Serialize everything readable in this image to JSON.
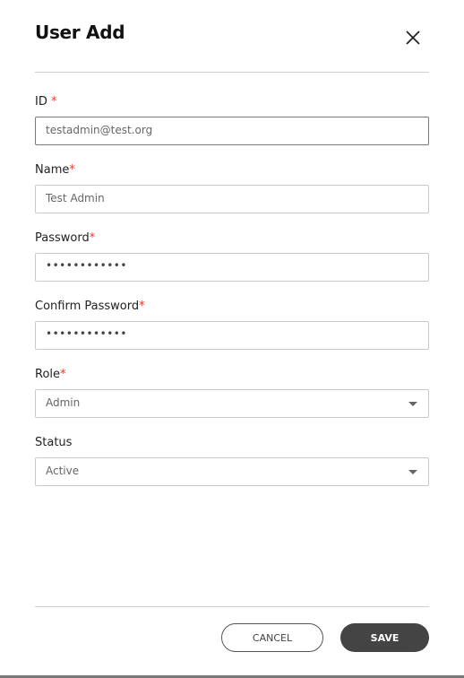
{
  "dialog": {
    "title": "User Add",
    "close_icon": "close-icon"
  },
  "fields": {
    "id": {
      "label": "ID",
      "required": "*",
      "value": "testadmin@test.org"
    },
    "name": {
      "label": "Name",
      "required": "*",
      "value": "Test Admin"
    },
    "password": {
      "label": "Password",
      "required": "*",
      "value": "••••••••••••"
    },
    "confirm_password": {
      "label": "Confirm Password",
      "required": "*",
      "value": "••••••••••••"
    },
    "role": {
      "label": "Role",
      "required": "*",
      "value": "Admin"
    },
    "status": {
      "label": "Status",
      "value": "Active"
    }
  },
  "footer": {
    "cancel_label": "CANCEL",
    "save_label": "SAVE"
  },
  "colors": {
    "required": "#e53935",
    "primary_button": "#444444"
  }
}
